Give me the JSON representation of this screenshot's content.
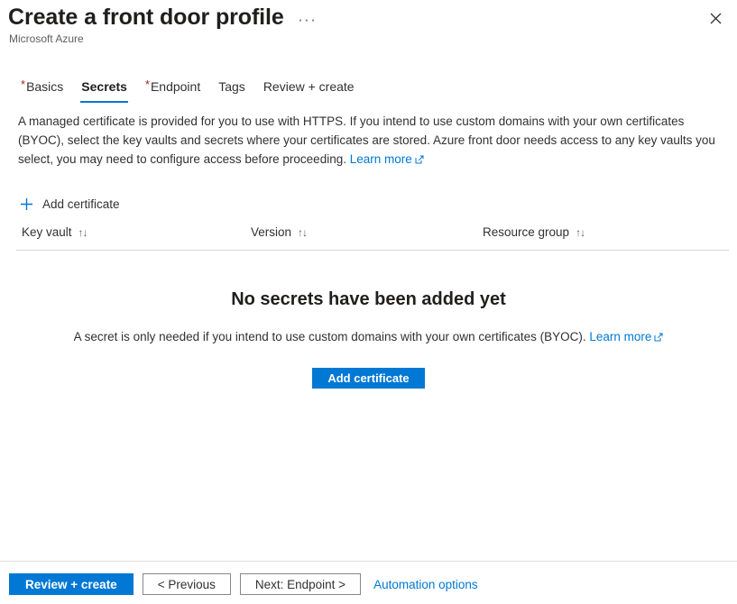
{
  "header": {
    "title": "Create a front door profile",
    "subtitle": "Microsoft Azure",
    "more_menu": "···",
    "close_label": "Close"
  },
  "tabs": [
    {
      "label": "Basics",
      "required": true,
      "active": false
    },
    {
      "label": "Secrets",
      "required": false,
      "active": true
    },
    {
      "label": "Endpoint",
      "required": true,
      "active": false
    },
    {
      "label": "Tags",
      "required": false,
      "active": false
    },
    {
      "label": "Review + create",
      "required": false,
      "active": false
    }
  ],
  "description": {
    "text": "A managed certificate is provided for you to use with HTTPS. If you intend to use custom domains with your own certificates (BYOC), select the key vaults and secrets where your certificates are stored. Azure front door needs access to any key vaults you select, you may need to configure access before proceeding.",
    "link_label": "Learn more"
  },
  "command_bar": {
    "add_certificate_label": "Add certificate",
    "plus_icon": "plus-icon"
  },
  "table": {
    "columns": [
      {
        "label": "Key vault",
        "sort": "↑↓"
      },
      {
        "label": "Version",
        "sort": "↑↓"
      },
      {
        "label": "Resource group",
        "sort": "↑↓"
      }
    ],
    "rows": []
  },
  "empty_state": {
    "title": "No secrets have been added yet",
    "subtitle": "A secret is only needed if you intend to use custom domains with your own certificates (BYOC).",
    "link_label": "Learn more",
    "button_label": "Add certificate"
  },
  "footer": {
    "review_create_label": "Review + create",
    "previous_label": "< Previous",
    "next_label": "Next: Endpoint >",
    "automation_label": "Automation options"
  },
  "colors": {
    "accent": "#0078d4",
    "required_star": "#a4262c",
    "text": "#323130",
    "muted_text": "#605e5c",
    "divider": "#d6d6d6"
  }
}
